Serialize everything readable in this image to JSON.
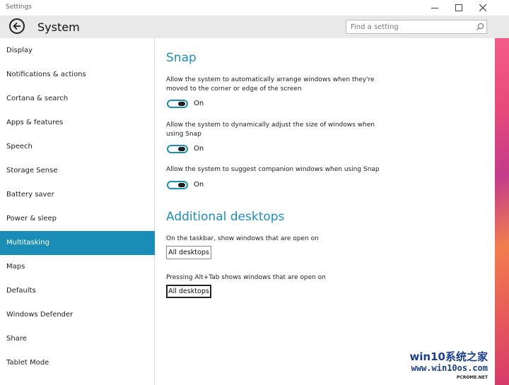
{
  "window": {
    "title": "Settings",
    "minimize_icon": "minimize-icon",
    "maximize_icon": "maximize-icon",
    "close_icon": "close-icon"
  },
  "header": {
    "title": "System",
    "back_icon": "back-arrow-icon",
    "search_placeholder": "Find a setting",
    "search_icon": "search-icon"
  },
  "sidebar": {
    "items": [
      {
        "label": "Display"
      },
      {
        "label": "Notifications & actions"
      },
      {
        "label": "Cortana & search"
      },
      {
        "label": "Apps & features"
      },
      {
        "label": "Speech"
      },
      {
        "label": "Storage Sense"
      },
      {
        "label": "Battery saver"
      },
      {
        "label": "Power & sleep"
      },
      {
        "label": "Multitasking"
      },
      {
        "label": "Maps"
      },
      {
        "label": "Defaults"
      },
      {
        "label": "Windows Defender"
      },
      {
        "label": "Share"
      },
      {
        "label": "Tablet Mode"
      }
    ],
    "selected": "Multitasking"
  },
  "snap": {
    "heading": "Snap",
    "settings": [
      {
        "description": "Allow the system to automatically arrange windows when they're moved to the corner or edge of the screen",
        "state": "On"
      },
      {
        "description": "Allow the system to dynamically adjust the size of windows when using Snap",
        "state": "On"
      },
      {
        "description": "Allow the system to suggest companion windows when using Snap",
        "state": "On"
      }
    ]
  },
  "desktops": {
    "heading": "Additional desktops",
    "taskbar_label": "On the taskbar, show windows that are open on",
    "taskbar_value": "All desktops",
    "alttab_label": "Pressing Alt+Tab shows windows that are open on",
    "alttab_value": "All desktops"
  },
  "watermark": {
    "line1": "win10系统之家",
    "line2": "www.win10os.com",
    "line3": "PCROME.NET"
  },
  "colors": {
    "accent": "#1a8db6",
    "heading": "#1b8fbd",
    "header_bg": "#e9e9e9"
  }
}
